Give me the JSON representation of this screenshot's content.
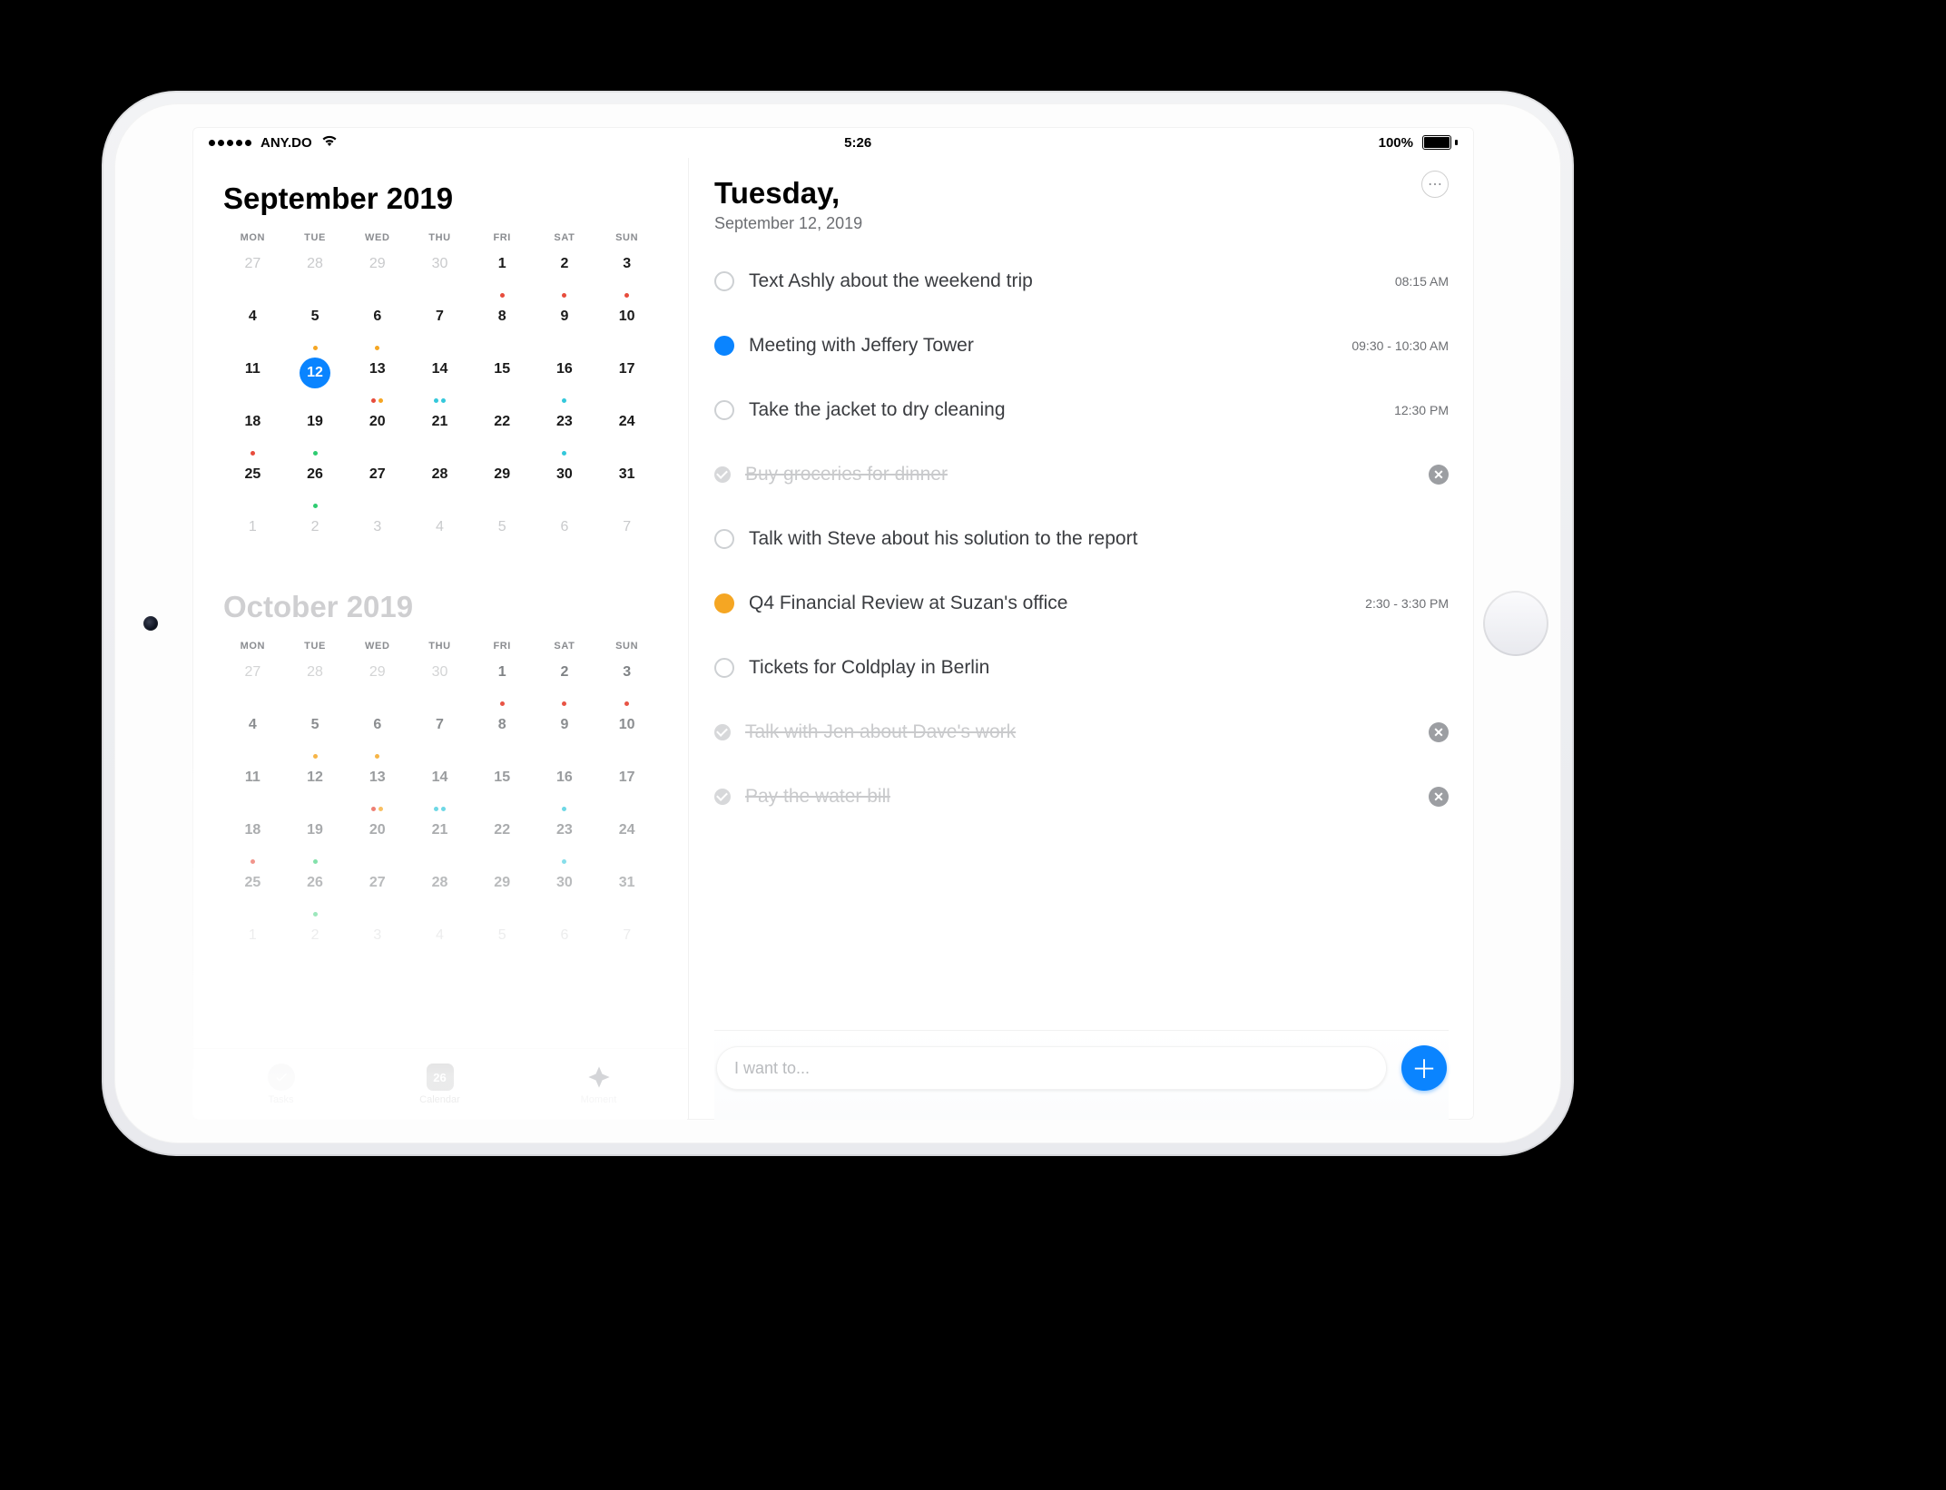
{
  "statusbar": {
    "carrier": "ANY.DO",
    "time": "5:26",
    "batteryLabel": "100%"
  },
  "month1": {
    "title": "September 2019",
    "dow": [
      "MON",
      "TUE",
      "WED",
      "THU",
      "FRI",
      "SAT",
      "SUN"
    ],
    "selectedDay": 12,
    "weeks": [
      [
        {
          "n": 27,
          "o": true
        },
        {
          "n": 28,
          "o": true
        },
        {
          "n": 29,
          "o": true
        },
        {
          "n": 30,
          "o": true
        },
        {
          "n": 1,
          "d": [
            "#e74c3c"
          ]
        },
        {
          "n": 2,
          "d": [
            "#e74c3c"
          ]
        },
        {
          "n": 3,
          "d": [
            "#e74c3c"
          ]
        }
      ],
      [
        {
          "n": 4
        },
        {
          "n": 5,
          "d": [
            "#f5a623"
          ]
        },
        {
          "n": 6,
          "d": [
            "#f5a623"
          ]
        },
        {
          "n": 7
        },
        {
          "n": 8
        },
        {
          "n": 9
        },
        {
          "n": 10
        }
      ],
      [
        {
          "n": 11
        },
        {
          "n": 12
        },
        {
          "n": 13,
          "d": [
            "#e74c3c",
            "#f5a623"
          ]
        },
        {
          "n": 14,
          "d": [
            "#34c8db",
            "#34c8db"
          ]
        },
        {
          "n": 15
        },
        {
          "n": 16,
          "d": [
            "#34c8db"
          ]
        },
        {
          "n": 17
        }
      ],
      [
        {
          "n": 18,
          "d": [
            "#e74c3c"
          ]
        },
        {
          "n": 19,
          "d": [
            "#2ecc71"
          ]
        },
        {
          "n": 20
        },
        {
          "n": 21
        },
        {
          "n": 22
        },
        {
          "n": 23,
          "d": [
            "#34c8db"
          ]
        },
        {
          "n": 24
        }
      ],
      [
        {
          "n": 25
        },
        {
          "n": 26,
          "d": [
            "#2ecc71"
          ]
        },
        {
          "n": 27
        },
        {
          "n": 28
        },
        {
          "n": 29
        },
        {
          "n": 30
        },
        {
          "n": 31
        }
      ],
      [
        {
          "n": 1,
          "o": true
        },
        {
          "n": 2,
          "o": true
        },
        {
          "n": 3,
          "o": true
        },
        {
          "n": 4,
          "o": true
        },
        {
          "n": 5,
          "o": true
        },
        {
          "n": 6,
          "o": true
        },
        {
          "n": 7,
          "o": true
        }
      ]
    ]
  },
  "month2": {
    "title": "October 2019",
    "dow": [
      "MON",
      "TUE",
      "WED",
      "THU",
      "FRI",
      "SAT",
      "SUN"
    ],
    "weeks": [
      [
        {
          "n": 27,
          "o": true
        },
        {
          "n": 28,
          "o": true
        },
        {
          "n": 29,
          "o": true
        },
        {
          "n": 30,
          "o": true
        },
        {
          "n": 1,
          "d": [
            "#e74c3c"
          ]
        },
        {
          "n": 2,
          "d": [
            "#e74c3c"
          ]
        },
        {
          "n": 3,
          "d": [
            "#e74c3c"
          ]
        }
      ],
      [
        {
          "n": 4
        },
        {
          "n": 5,
          "d": [
            "#f5a623"
          ]
        },
        {
          "n": 6,
          "d": [
            "#f5a623"
          ]
        },
        {
          "n": 7
        },
        {
          "n": 8
        },
        {
          "n": 9
        },
        {
          "n": 10
        }
      ],
      [
        {
          "n": 11
        },
        {
          "n": 12
        },
        {
          "n": 13,
          "d": [
            "#e74c3c",
            "#f5a623"
          ]
        },
        {
          "n": 14,
          "d": [
            "#34c8db",
            "#34c8db"
          ]
        },
        {
          "n": 15
        },
        {
          "n": 16,
          "d": [
            "#34c8db"
          ]
        },
        {
          "n": 17
        }
      ],
      [
        {
          "n": 18,
          "d": [
            "#e74c3c"
          ]
        },
        {
          "n": 19,
          "d": [
            "#2ecc71"
          ]
        },
        {
          "n": 20
        },
        {
          "n": 21
        },
        {
          "n": 22
        },
        {
          "n": 23,
          "d": [
            "#34c8db"
          ]
        },
        {
          "n": 24
        }
      ],
      [
        {
          "n": 25
        },
        {
          "n": 26,
          "d": [
            "#2ecc71"
          ]
        },
        {
          "n": 27
        },
        {
          "n": 28
        },
        {
          "n": 29
        },
        {
          "n": 30
        },
        {
          "n": 31
        }
      ],
      [
        {
          "n": 1,
          "o": true
        },
        {
          "n": 2,
          "o": true
        },
        {
          "n": 3,
          "o": true
        },
        {
          "n": 4,
          "o": true
        },
        {
          "n": 5,
          "o": true
        },
        {
          "n": 6,
          "o": true
        },
        {
          "n": 7,
          "o": true
        }
      ]
    ]
  },
  "nav": {
    "tasks": "Tasks",
    "calendar": "Calendar",
    "calendarIconDay": "26",
    "moment": "Moment"
  },
  "day": {
    "title": "Tuesday,",
    "subtitle": "September 12, 2019"
  },
  "tasks": [
    {
      "text": "Text Ashly about the weekend trip",
      "time": "08:15 AM",
      "bullet": "empty"
    },
    {
      "text": "Meeting with Jeffery Tower",
      "time": "09:30 - 10:30 AM",
      "bullet": "blue"
    },
    {
      "text": "Take the jacket to dry cleaning",
      "time": "12:30 PM",
      "bullet": "empty"
    },
    {
      "text": "Buy groceries for dinner",
      "done": true
    },
    {
      "text": "Talk with Steve about his solution to the report",
      "bullet": "empty"
    },
    {
      "text": "Q4 Financial Review at Suzan's office",
      "time": "2:30 - 3:30 PM",
      "bullet": "yellow"
    },
    {
      "text": "Tickets for Coldplay in Berlin",
      "bullet": "empty"
    },
    {
      "text": "Talk with Jen about Dave's work",
      "done": true
    },
    {
      "text": "Pay the water bill",
      "done": true
    }
  ],
  "composer": {
    "placeholder": "I want to..."
  },
  "colors": {
    "accent": "#0a84ff",
    "yellow": "#f5a623"
  }
}
